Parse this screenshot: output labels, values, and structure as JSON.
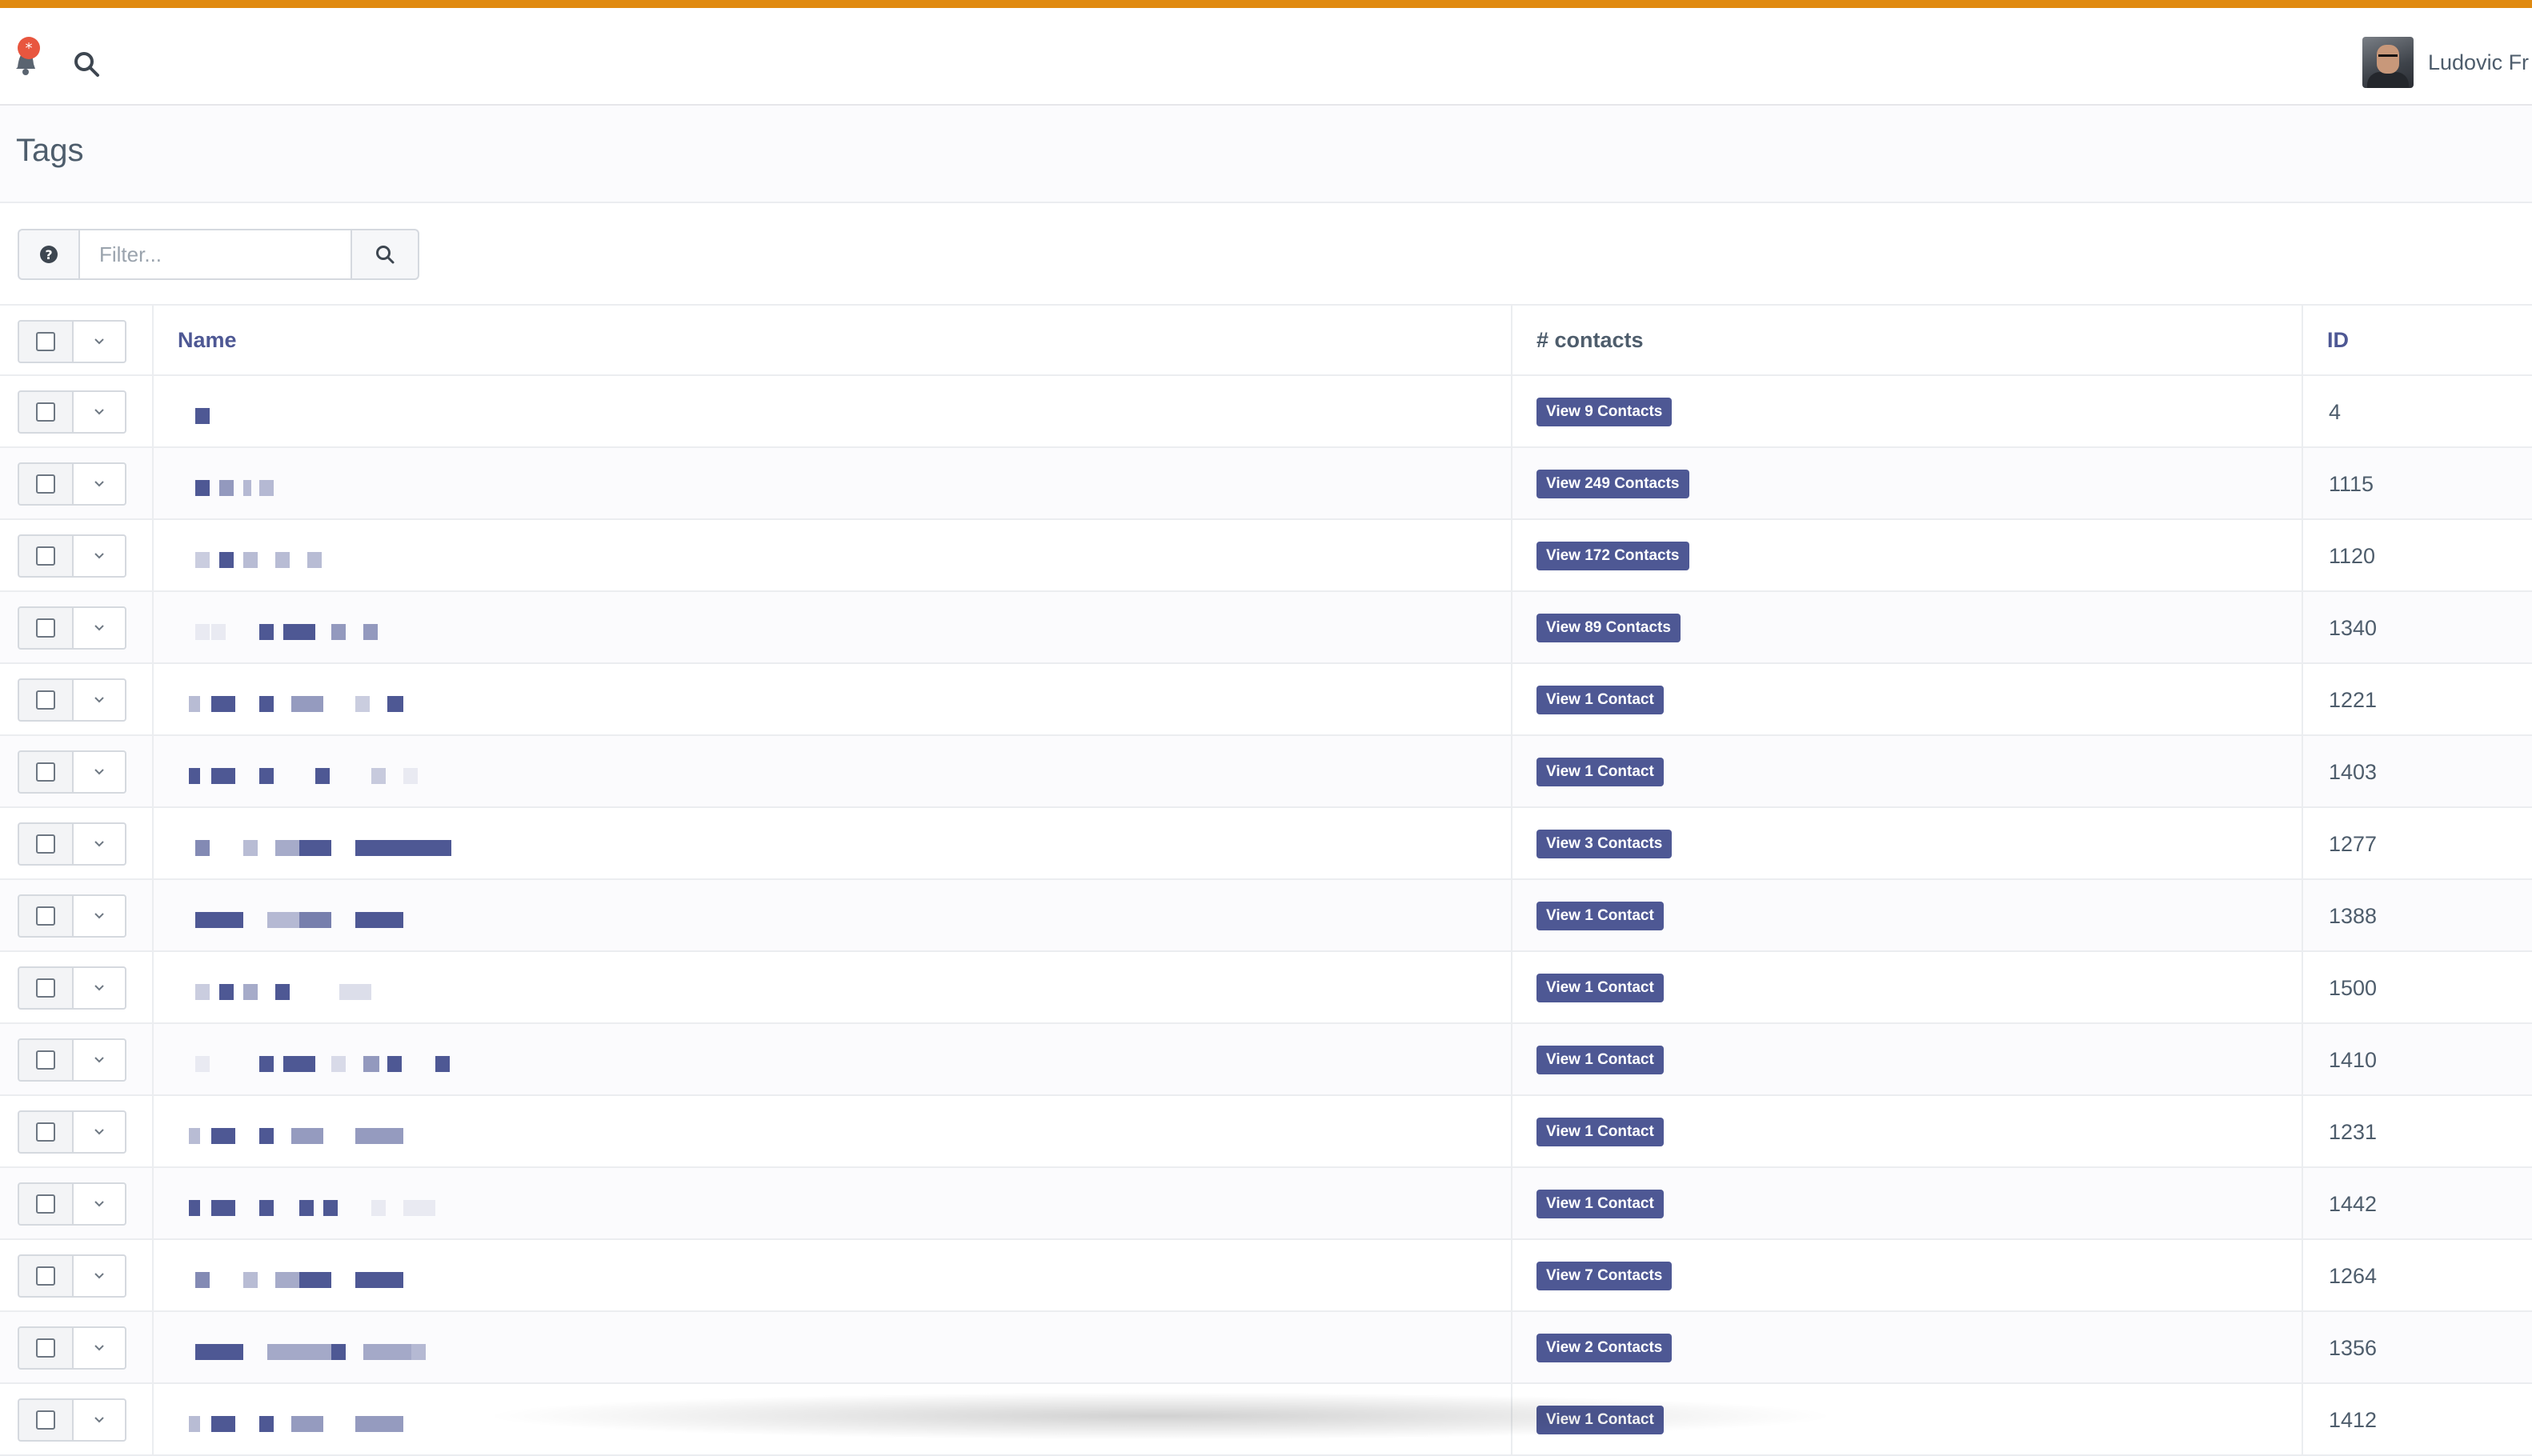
{
  "header": {
    "user_name": "Ludovic Fr",
    "notification_icon": "bell-icon",
    "search_icon": "search-icon"
  },
  "page": {
    "title": "Tags"
  },
  "filter": {
    "placeholder": "Filter...",
    "help_icon": "question-circle-icon",
    "search_icon": "search-icon"
  },
  "table": {
    "columns": {
      "name": "Name",
      "contacts": "# contacts",
      "id": "ID"
    },
    "rows": [
      {
        "contacts_label": "View 9 Contacts",
        "id": "4"
      },
      {
        "contacts_label": "View 249 Contacts",
        "id": "1115"
      },
      {
        "contacts_label": "View 172 Contacts",
        "id": "1120"
      },
      {
        "contacts_label": "View 89 Contacts",
        "id": "1340"
      },
      {
        "contacts_label": "View 1 Contact",
        "id": "1221"
      },
      {
        "contacts_label": "View 1 Contact",
        "id": "1403"
      },
      {
        "contacts_label": "View 3 Contacts",
        "id": "1277"
      },
      {
        "contacts_label": "View 1 Contact",
        "id": "1388"
      },
      {
        "contacts_label": "View 1 Contact",
        "id": "1500"
      },
      {
        "contacts_label": "View 1 Contact",
        "id": "1410"
      },
      {
        "contacts_label": "View 1 Contact",
        "id": "1231"
      },
      {
        "contacts_label": "View 1 Contact",
        "id": "1442"
      },
      {
        "contacts_label": "View 7 Contacts",
        "id": "1264"
      },
      {
        "contacts_label": "View 2 Contacts",
        "id": "1356"
      },
      {
        "contacts_label": "View 1 Contact",
        "id": "1412"
      }
    ]
  },
  "colors": {
    "accent_bar": "#e08a10",
    "badge": "#4e5894",
    "notification_dot": "#e8563f"
  }
}
